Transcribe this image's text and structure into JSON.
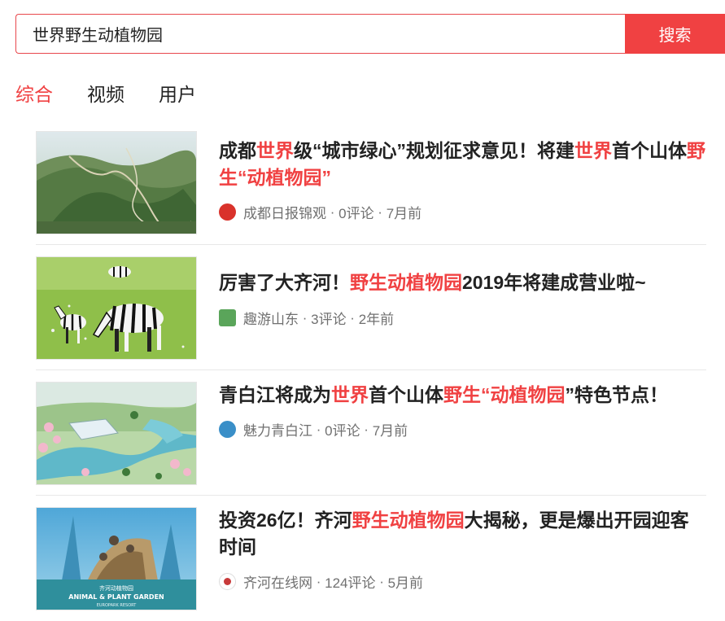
{
  "search": {
    "value": "世界野生动植物园",
    "button_label": "搜索"
  },
  "tabs": [
    {
      "label": "综合",
      "active": true
    },
    {
      "label": "视频",
      "active": false
    },
    {
      "label": "用户",
      "active": false
    }
  ],
  "articles": [
    {
      "title_parts": [
        {
          "text": "成都",
          "hl": false
        },
        {
          "text": "世界",
          "hl": true
        },
        {
          "text": "级“城市绿心”规划征求意见！将建",
          "hl": false
        },
        {
          "text": "世界",
          "hl": true
        },
        {
          "text": "首个山体",
          "hl": false
        },
        {
          "text": "野生",
          "hl": true
        },
        {
          "text": "“",
          "hl": false
        },
        {
          "text": "动植物园",
          "hl": true
        },
        {
          "text": "”",
          "hl": false
        }
      ],
      "source": "成都日报锦观",
      "comments": "0评论",
      "time": "7月前",
      "icon": "chengdu-daily-logo-icon",
      "icon_color": "#d9322b",
      "thumb": "mountain-aerial"
    },
    {
      "title_parts": [
        {
          "text": "厉害了大齐河！",
          "hl": false
        },
        {
          "text": "野生动植物园",
          "hl": true
        },
        {
          "text": "2019年将建成营业啦~",
          "hl": false
        }
      ],
      "source": "趣游山东",
      "comments": "3评论",
      "time": "2年前",
      "icon": "quyou-shandong-logo-icon",
      "icon_color": "#5aa55a",
      "thumb": "zebras"
    },
    {
      "title_parts": [
        {
          "text": "青白江将成为",
          "hl": false
        },
        {
          "text": "世界",
          "hl": true
        },
        {
          "text": "首个山体",
          "hl": false
        },
        {
          "text": "野生",
          "hl": true
        },
        {
          "text": "“",
          "hl": false
        },
        {
          "text": "动植物园",
          "hl": true
        },
        {
          "text": "”特色节点！",
          "hl": false
        }
      ],
      "source": "魅力青白江",
      "comments": "0评论",
      "time": "7月前",
      "icon": "qingbaijiang-logo-icon",
      "icon_color": "#3a8fc8",
      "thumb": "park-render"
    },
    {
      "title_parts": [
        {
          "text": "投资26亿！齐河",
          "hl": false
        },
        {
          "text": "野生动植物园",
          "hl": true
        },
        {
          "text": "大揭秘，更是爆出开园迎客时间",
          "hl": false
        }
      ],
      "source": "齐河在线网",
      "comments": "124评论",
      "time": "5月前",
      "icon": "qihe-online-logo-icon",
      "icon_color": "#c83a3a",
      "thumb": "animal-garden",
      "thumb_text": {
        "cn": "齐河动植物园",
        "en": "ANIMAL & PLANT GARDEN",
        "sub": "EUROPARK RESORT"
      }
    }
  ],
  "colors": {
    "accent": "#f04142",
    "meta": "#707070",
    "title": "#222222"
  }
}
